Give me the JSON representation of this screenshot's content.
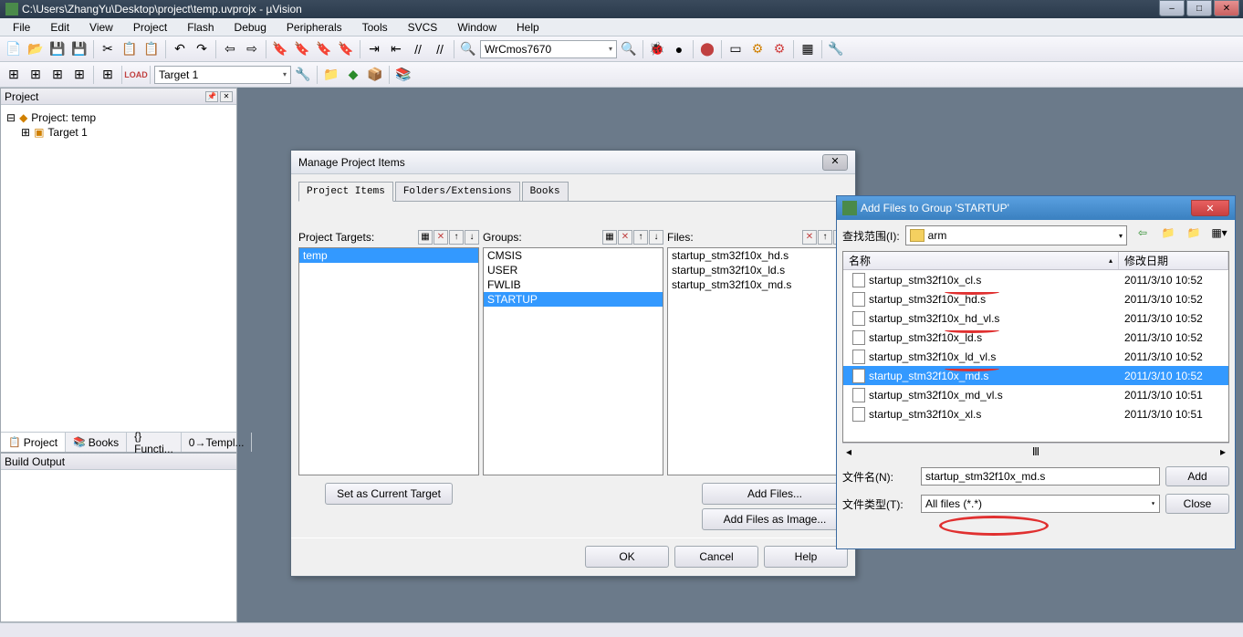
{
  "window": {
    "title": "C:\\Users\\ZhangYu\\Desktop\\project\\temp.uvprojx - µVision"
  },
  "menu": [
    "File",
    "Edit",
    "View",
    "Project",
    "Flash",
    "Debug",
    "Peripherals",
    "Tools",
    "SVCS",
    "Window",
    "Help"
  ],
  "toolbar": {
    "search": "",
    "target_combo": "WrCmos7670",
    "target2": "Target 1"
  },
  "project_panel": {
    "title": "Project",
    "root": "Project: temp",
    "child": "Target 1"
  },
  "tabs": {
    "t1": "Project",
    "t2": "Books",
    "t3": "{} Functi...",
    "t4": "0→Templ..."
  },
  "build_output": {
    "title": "Build Output"
  },
  "mpi": {
    "title": "Manage Project Items",
    "tabs": {
      "t1": "Project Items",
      "t2": "Folders/Extensions",
      "t3": "Books"
    },
    "cols": {
      "c1": "Project Targets:",
      "c2": "Groups:",
      "c3": "Files:"
    },
    "targets": [
      "temp"
    ],
    "groups": [
      "CMSIS",
      "USER",
      "FWLIB",
      "STARTUP"
    ],
    "files": [
      "startup_stm32f10x_hd.s",
      "startup_stm32f10x_ld.s",
      "startup_stm32f10x_md.s"
    ],
    "btns": {
      "set": "Set as Current Target",
      "addf": "Add Files...",
      "addi": "Add Files as Image...",
      "ok": "OK",
      "cancel": "Cancel",
      "help": "Help"
    }
  },
  "af": {
    "title": "Add Files to Group 'STARTUP'",
    "lookup_label": "查找范围(I):",
    "folder": "arm",
    "cols": {
      "name": "名称",
      "date": "修改日期"
    },
    "files": [
      {
        "n": "startup_stm32f10x_cl.s",
        "d": "2011/3/10 10:52"
      },
      {
        "n": "startup_stm32f10x_hd.s",
        "d": "2011/3/10 10:52"
      },
      {
        "n": "startup_stm32f10x_hd_vl.s",
        "d": "2011/3/10 10:52"
      },
      {
        "n": "startup_stm32f10x_ld.s",
        "d": "2011/3/10 10:52"
      },
      {
        "n": "startup_stm32f10x_ld_vl.s",
        "d": "2011/3/10 10:52"
      },
      {
        "n": "startup_stm32f10x_md.s",
        "d": "2011/3/10 10:52"
      },
      {
        "n": "startup_stm32f10x_md_vl.s",
        "d": "2011/3/10 10:51"
      },
      {
        "n": "startup_stm32f10x_xl.s",
        "d": "2011/3/10 10:51"
      }
    ],
    "fn_label": "文件名(N):",
    "fn_value": "startup_stm32f10x_md.s",
    "ft_label": "文件类型(T):",
    "ft_value": "All files (*.*)",
    "add": "Add",
    "close": "Close"
  }
}
